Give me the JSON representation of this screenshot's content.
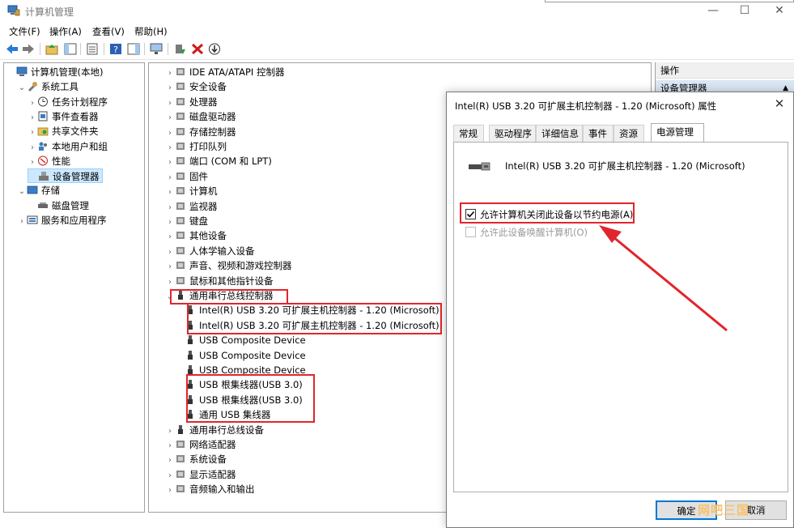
{
  "window": {
    "title": "计算机管理"
  },
  "menu": [
    "文件(F)",
    "操作(A)",
    "查看(V)",
    "帮助(H)"
  ],
  "left_tree": [
    {
      "label": "计算机管理(本地)",
      "indent": 0,
      "chev": ""
    },
    {
      "label": "系统工具",
      "indent": 1,
      "chev": "v"
    },
    {
      "label": "任务计划程序",
      "indent": 2,
      "chev": ">"
    },
    {
      "label": "事件查看器",
      "indent": 2,
      "chev": ">"
    },
    {
      "label": "共享文件夹",
      "indent": 2,
      "chev": ">"
    },
    {
      "label": "本地用户和组",
      "indent": 2,
      "chev": ">"
    },
    {
      "label": "性能",
      "indent": 2,
      "chev": ">"
    },
    {
      "label": "设备管理器",
      "indent": 2,
      "chev": "",
      "selected": true
    },
    {
      "label": "存储",
      "indent": 1,
      "chev": "v"
    },
    {
      "label": "磁盘管理",
      "indent": 2,
      "chev": ""
    },
    {
      "label": "服务和应用程序",
      "indent": 1,
      "chev": ">"
    }
  ],
  "device_tree": [
    {
      "label": "IDE ATA/ATAPI 控制器",
      "indent": 0,
      "chev": ">"
    },
    {
      "label": "安全设备",
      "indent": 0,
      "chev": ">"
    },
    {
      "label": "处理器",
      "indent": 0,
      "chev": ">"
    },
    {
      "label": "磁盘驱动器",
      "indent": 0,
      "chev": ">"
    },
    {
      "label": "存储控制器",
      "indent": 0,
      "chev": ">"
    },
    {
      "label": "打印队列",
      "indent": 0,
      "chev": ">"
    },
    {
      "label": "端口 (COM 和 LPT)",
      "indent": 0,
      "chev": ">"
    },
    {
      "label": "固件",
      "indent": 0,
      "chev": ">"
    },
    {
      "label": "计算机",
      "indent": 0,
      "chev": ">"
    },
    {
      "label": "监视器",
      "indent": 0,
      "chev": ">"
    },
    {
      "label": "键盘",
      "indent": 0,
      "chev": ">"
    },
    {
      "label": "其他设备",
      "indent": 0,
      "chev": ">"
    },
    {
      "label": "人体学输入设备",
      "indent": 0,
      "chev": ">"
    },
    {
      "label": "声音、视频和游戏控制器",
      "indent": 0,
      "chev": ">"
    },
    {
      "label": "鼠标和其他指针设备",
      "indent": 0,
      "chev": ">"
    },
    {
      "label": "通用串行总线控制器",
      "indent": 0,
      "chev": "v"
    },
    {
      "label": "Intel(R) USB 3.20 可扩展主机控制器 - 1.20 (Microsoft)",
      "indent": 1,
      "chev": ""
    },
    {
      "label": "Intel(R) USB 3.20 可扩展主机控制器 - 1.20 (Microsoft)",
      "indent": 1,
      "chev": ""
    },
    {
      "label": "USB Composite Device",
      "indent": 1,
      "chev": ""
    },
    {
      "label": "USB Composite Device",
      "indent": 1,
      "chev": ""
    },
    {
      "label": "USB Composite Device",
      "indent": 1,
      "chev": ""
    },
    {
      "label": "USB 根集线器(USB 3.0)",
      "indent": 1,
      "chev": ""
    },
    {
      "label": "USB 根集线器(USB 3.0)",
      "indent": 1,
      "chev": ""
    },
    {
      "label": "通用 USB 集线器",
      "indent": 1,
      "chev": ""
    },
    {
      "label": "通用串行总线设备",
      "indent": 0,
      "chev": ">"
    },
    {
      "label": "网络适配器",
      "indent": 0,
      "chev": ">"
    },
    {
      "label": "系统设备",
      "indent": 0,
      "chev": ">"
    },
    {
      "label": "显示适配器",
      "indent": 0,
      "chev": ">"
    },
    {
      "label": "音频输入和输出",
      "indent": 0,
      "chev": ">"
    }
  ],
  "actions": {
    "header": "操作",
    "section": "设备管理器"
  },
  "dialog": {
    "title": "Intel(R) USB 3.20 可扩展主机控制器 - 1.20 (Microsoft) 属性",
    "tabs": [
      "常规",
      "驱动程序",
      "详细信息",
      "事件",
      "资源",
      "电源管理"
    ],
    "active_tab": "电源管理",
    "device_name": "Intel(R) USB 3.20 可扩展主机控制器 - 1.20 (Microsoft)",
    "option_allow_off": {
      "label": "允许计算机关闭此设备以节约电源(A)",
      "checked": true
    },
    "option_wake": {
      "label": "允许此设备唤醒计算机(O)",
      "checked": false,
      "disabled": true
    },
    "ok_label": "确定",
    "cancel_label": "取消"
  },
  "watermark": "网吧三国",
  "colors": {
    "highlight": "#e0262c",
    "selection": "#cce8ff",
    "accent": "#0078d7"
  }
}
